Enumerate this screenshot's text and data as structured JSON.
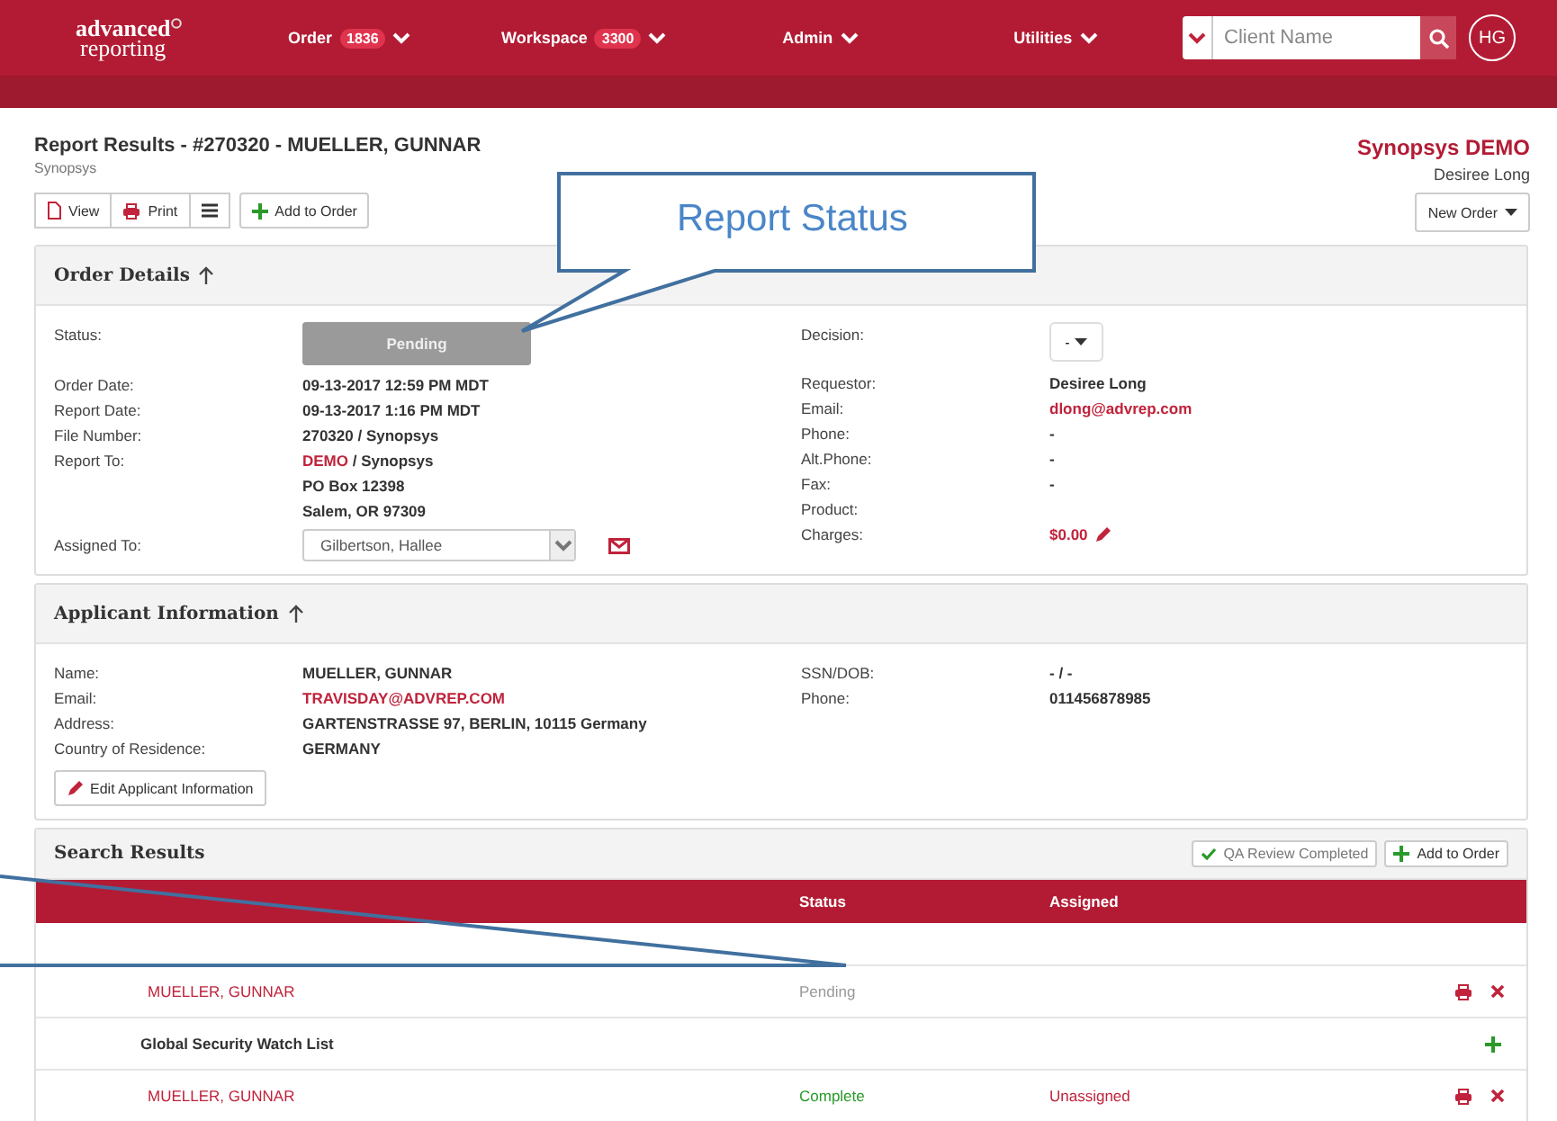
{
  "nav": {
    "logo_top": "advanced",
    "logo_bottom": "reporting",
    "menus": [
      {
        "label": "Order",
        "badge": "1836"
      },
      {
        "label": "Workspace",
        "badge": "3300"
      },
      {
        "label": "Admin"
      },
      {
        "label": "Utilities"
      }
    ],
    "search": {
      "placeholder": "Client Name"
    },
    "avatar": "HG"
  },
  "page": {
    "title": "Report Results - #270320 - MUELLER, GUNNAR",
    "subtitle": "Synopsys",
    "company": "Synopsys DEMO",
    "user": "Desiree Long",
    "toolbar": [
      {
        "kind": "view",
        "label": "View"
      },
      {
        "kind": "print",
        "label": "Print"
      },
      {
        "kind": "menu"
      },
      {
        "kind": "add",
        "label": "Add to Order"
      }
    ],
    "new_order": "New Order"
  },
  "order_details": {
    "title": "Order Details",
    "status": {
      "label": "Status:",
      "value": "Pending"
    },
    "left": [
      {
        "label": "Order Date:",
        "value": "09-13-2017 12:59 PM MDT"
      },
      {
        "label": "Report Date:",
        "value": "09-13-2017 1:16 PM MDT"
      },
      {
        "label": "File Number:",
        "value": "270320 / Synopsys"
      },
      {
        "label": "Report To:",
        "link": "DEMO",
        "value": " / Synopsys",
        "lines": [
          "PO Box 12398",
          "Salem, OR 97309"
        ]
      }
    ],
    "assigned": {
      "label": "Assigned To:",
      "value": "Gilbertson, Hallee"
    },
    "decision": {
      "label": "Decision:",
      "value": "-"
    },
    "right": [
      {
        "label": "Requestor:",
        "value": "Desiree Long"
      },
      {
        "label": "Email:",
        "value": "dlong@advrep.com",
        "kind": "link"
      },
      {
        "label": "Phone:",
        "value": "-"
      },
      {
        "label": "Alt.Phone:",
        "value": "-"
      },
      {
        "label": "Fax:",
        "value": "-"
      },
      {
        "label": "Product:"
      },
      {
        "label": "Charges:",
        "value": "$0.00",
        "kind": "money"
      }
    ]
  },
  "applicant": {
    "title": "Applicant Information",
    "left": [
      {
        "label": "Name:",
        "value": "MUELLER, GUNNAR"
      },
      {
        "label": "Email:",
        "value": "TRAVISDAY@ADVREP.COM",
        "kind": "link"
      },
      {
        "label": "Address:",
        "value": "GARTENSTRASSE 97, BERLIN, 10115 Germany"
      },
      {
        "label": "Country of Residence:",
        "value": "GERMANY"
      }
    ],
    "right": [
      {
        "label": "SSN/DOB:",
        "value": "- / -"
      },
      {
        "label": "Phone:",
        "value": "011456878985"
      }
    ],
    "edit_button": "Edit Applicant Information"
  },
  "search_results": {
    "title": "Search Results",
    "qa_button": "QA Review Completed",
    "add_button": "Add to Order",
    "columns": [
      "Status",
      "Assigned"
    ],
    "rows": [
      {
        "kind": "blank"
      },
      {
        "kind": "result",
        "name": "MUELLER, GUNNAR",
        "status": "Pending",
        "color": "#999999"
      },
      {
        "kind": "group",
        "name": "Global Security Watch List"
      },
      {
        "kind": "result",
        "name": "MUELLER, GUNNAR",
        "status": "Complete",
        "color": "#2a9a2a",
        "assigned": "Unassigned"
      }
    ]
  },
  "callouts": [
    {
      "kind": "box",
      "text": "Report Status"
    },
    {
      "kind": "lines"
    }
  ]
}
